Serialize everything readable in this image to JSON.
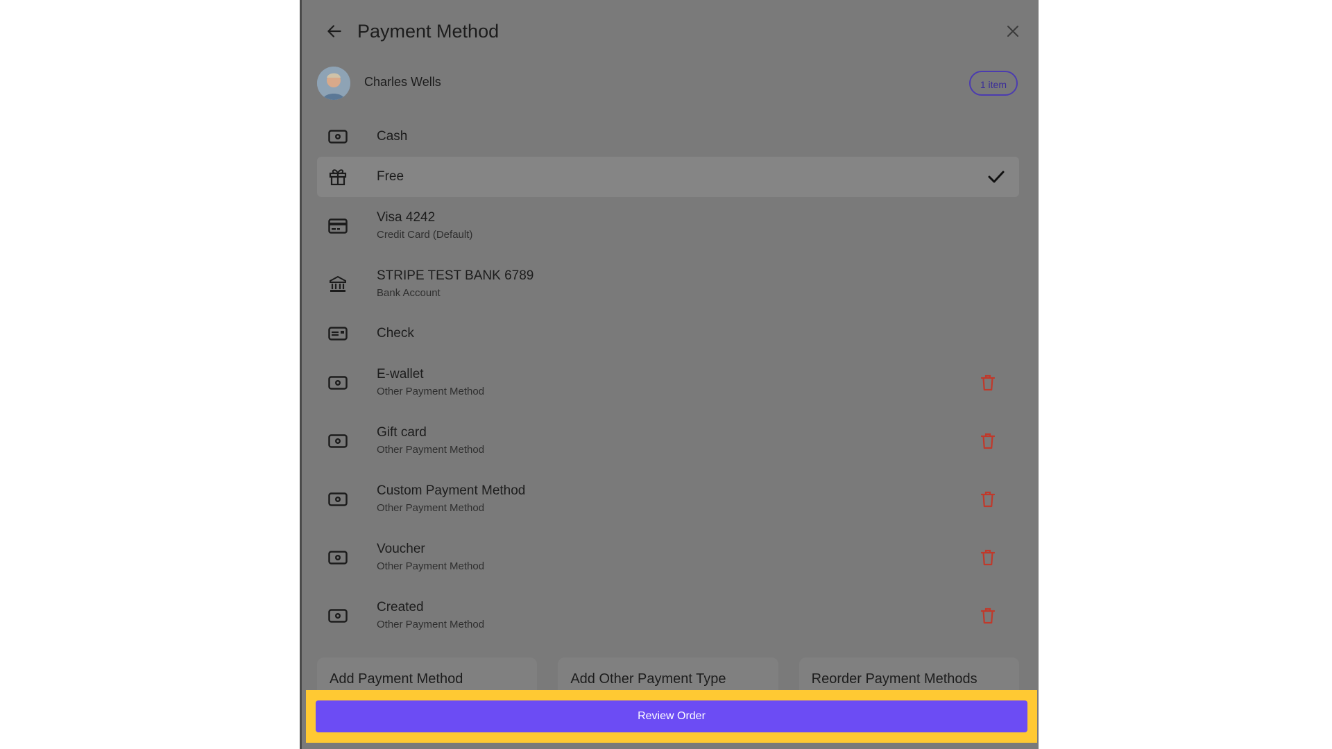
{
  "header": {
    "title": "Payment Method"
  },
  "customer": {
    "name": "Charles Wells",
    "item_badge": "1 item"
  },
  "methods": [
    {
      "name": "Cash",
      "sub": "",
      "icon": "cash-icon",
      "selected": false,
      "deletable": false
    },
    {
      "name": "Free",
      "sub": "",
      "icon": "gift-icon",
      "selected": true,
      "deletable": false
    },
    {
      "name": "Visa 4242",
      "sub": "Credit Card (Default)",
      "icon": "credit-card-icon",
      "selected": false,
      "deletable": false
    },
    {
      "name": "STRIPE TEST BANK 6789",
      "sub": "Bank Account",
      "icon": "bank-icon",
      "selected": false,
      "deletable": false
    },
    {
      "name": "Check",
      "sub": "",
      "icon": "check-payment-icon",
      "selected": false,
      "deletable": false
    },
    {
      "name": "E-wallet",
      "sub": "Other Payment Method",
      "icon": "cash-icon",
      "selected": false,
      "deletable": true
    },
    {
      "name": "Gift card",
      "sub": "Other Payment Method",
      "icon": "cash-icon",
      "selected": false,
      "deletable": true
    },
    {
      "name": "Custom Payment Method",
      "sub": "Other Payment Method",
      "icon": "cash-icon",
      "selected": false,
      "deletable": true
    },
    {
      "name": "Voucher",
      "sub": "Other Payment Method",
      "icon": "cash-icon",
      "selected": false,
      "deletable": true
    },
    {
      "name": "Created",
      "sub": "Other Payment Method",
      "icon": "cash-icon",
      "selected": false,
      "deletable": true
    }
  ],
  "actions": {
    "add_payment_method": "Add Payment Method",
    "add_other_payment_type": "Add Other Payment Type",
    "reorder_payment_methods": "Reorder Payment Methods"
  },
  "footer": {
    "review_order": "Review Order"
  },
  "colors": {
    "accent": "#6c4cf4",
    "highlight": "#ffc933",
    "delete": "#c0392b",
    "overlay": "#7a7a7a"
  }
}
